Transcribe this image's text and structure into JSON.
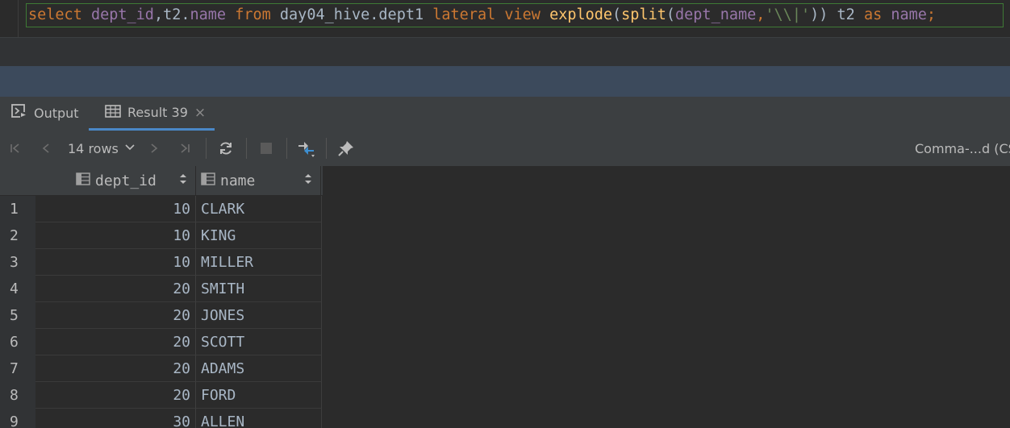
{
  "editor": {
    "sql_tokens": [
      {
        "t": "select ",
        "c": "kw"
      },
      {
        "t": "dept_id",
        "c": "id"
      },
      {
        "t": ",t2.",
        "c": "pl"
      },
      {
        "t": "name ",
        "c": "id"
      },
      {
        "t": "from ",
        "c": "kw"
      },
      {
        "t": "day04_hive.dept1 ",
        "c": "pl"
      },
      {
        "t": "lateral view ",
        "c": "kw"
      },
      {
        "t": "explode",
        "c": "fn"
      },
      {
        "t": "(",
        "c": "pl"
      },
      {
        "t": "split",
        "c": "fn"
      },
      {
        "t": "(",
        "c": "pl"
      },
      {
        "t": "dept_name",
        "c": "id"
      },
      {
        "t": ",",
        "c": "kw"
      },
      {
        "t": "'\\\\|'",
        "c": "str"
      },
      {
        "t": ")) t2 ",
        "c": "pl"
      },
      {
        "t": "as ",
        "c": "kw"
      },
      {
        "t": "name",
        "c": "id"
      },
      {
        "t": ";",
        "c": "kw"
      }
    ]
  },
  "tabs": {
    "output_label": "Output",
    "result_label": "Result 39",
    "close_glyph": "×"
  },
  "toolbar": {
    "rows_label": "14 rows",
    "format_label": "Comma-...d (CS"
  },
  "grid": {
    "columns": [
      "dept_id",
      "name"
    ],
    "rows": [
      {
        "n": "1",
        "dept_id": "10",
        "name": "CLARK"
      },
      {
        "n": "2",
        "dept_id": "10",
        "name": "KING"
      },
      {
        "n": "3",
        "dept_id": "10",
        "name": "MILLER"
      },
      {
        "n": "4",
        "dept_id": "20",
        "name": "SMITH"
      },
      {
        "n": "5",
        "dept_id": "20",
        "name": "JONES"
      },
      {
        "n": "6",
        "dept_id": "20",
        "name": "SCOTT"
      },
      {
        "n": "7",
        "dept_id": "20",
        "name": "ADAMS"
      },
      {
        "n": "8",
        "dept_id": "20",
        "name": "FORD"
      },
      {
        "n": "9",
        "dept_id": "30",
        "name": "ALLEN"
      }
    ]
  },
  "icons": {
    "first_page": "first-page-icon",
    "prev_page": "previous-page-icon",
    "next_page": "next-page-icon",
    "last_page": "last-page-icon",
    "reload": "reload-icon",
    "stop": "stop-icon",
    "compare": "compare-icon",
    "pin": "pin-icon"
  }
}
